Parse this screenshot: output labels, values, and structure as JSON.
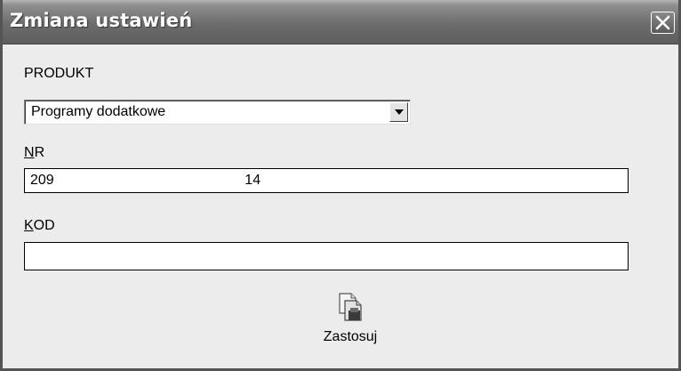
{
  "window": {
    "title": "Zmiana ustawień"
  },
  "produkt": {
    "label": "PRODUKT",
    "selected": "Programy dodatkowe"
  },
  "nr": {
    "label_accel": "N",
    "label_rest": "R",
    "value": "209                                                                   14"
  },
  "kod": {
    "label_accel": "K",
    "label_rest": "OD",
    "value": ""
  },
  "apply_button": {
    "label": "Zastosuj",
    "icon": "apply-document-icon"
  },
  "colors": {
    "titlebar": "#6c6c6c",
    "dialog_background": "#ececec"
  }
}
